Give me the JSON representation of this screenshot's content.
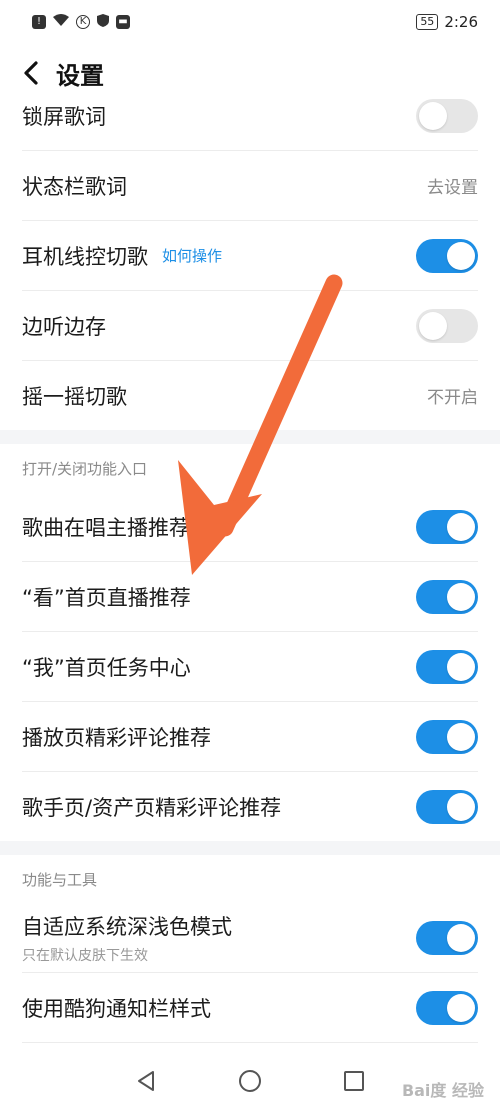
{
  "statusbar": {
    "time": "2:26",
    "battery": "55"
  },
  "header": {
    "title": "设置"
  },
  "rows_top": [
    {
      "label": "锁屏歌词",
      "control": "toggle",
      "on": false
    },
    {
      "label": "状态栏歌词",
      "control": "value",
      "value": "去设置"
    },
    {
      "label": "耳机线控切歌",
      "control": "toggle",
      "on": true,
      "link": "如何操作"
    },
    {
      "label": "边听边存",
      "control": "toggle",
      "on": false
    },
    {
      "label": "摇一摇切歌",
      "control": "value",
      "value": "不开启"
    }
  ],
  "section_entry": {
    "title": "打开/关闭功能入口",
    "rows": [
      {
        "label": "歌曲在唱主播推荐",
        "on": true
      },
      {
        "label": "“看”首页直播推荐",
        "on": true
      },
      {
        "label": "“我”首页任务中心",
        "on": true
      },
      {
        "label": "播放页精彩评论推荐",
        "on": true
      },
      {
        "label": "歌手页/资产页精彩评论推荐",
        "on": true
      }
    ]
  },
  "section_tools": {
    "title": "功能与工具",
    "rows": [
      {
        "label": "自适应系统深浅色模式",
        "sub": "只在默认皮肤下生效",
        "on": true
      },
      {
        "label": "使用酷狗通知栏样式",
        "on": true
      }
    ]
  },
  "colors": {
    "accent": "#1d8fe6",
    "toggle_off": "#e6e6e6",
    "arrow": "#f26b3a"
  },
  "watermark": "Bai度 经验"
}
